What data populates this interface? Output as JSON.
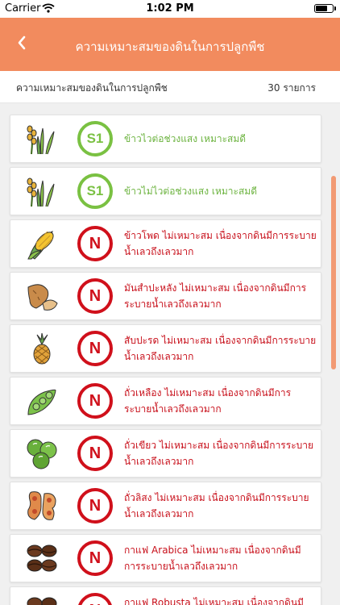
{
  "status_bar": {
    "carrier": "Carrier",
    "time": "1:02 PM"
  },
  "nav": {
    "title": "ความเหมาะสมของดินในการปลูกพืช"
  },
  "summary": {
    "label": "ความเหมาะสมของดินในการปลูกพืช",
    "count": "30 รายการ"
  },
  "colors": {
    "accent": "#f28b5e",
    "suitable": "#7ac142",
    "unsuitable": "#d0101b"
  },
  "items": [
    {
      "icon": "rice-icon",
      "badge": "S1",
      "status": "suitable",
      "text": "ข้าวไวต่อช่วงแสง เหมาะสมดี"
    },
    {
      "icon": "rice-icon",
      "badge": "S1",
      "status": "suitable",
      "text": "ข้าวไม่ไวต่อช่วงแสง เหมาะสมดี"
    },
    {
      "icon": "corn-icon",
      "badge": "N",
      "status": "unsuitable",
      "text": "ข้าวโพด ไม่เหมาะสม เนื่องจากดินมีการระบายน้ำเลวถึงเลวมาก"
    },
    {
      "icon": "cassava-icon",
      "badge": "N",
      "status": "unsuitable",
      "text": "มันสำปะหลัง ไม่เหมาะสม เนื่องจากดินมีการระบายน้ำเลวถึงเลวมาก"
    },
    {
      "icon": "pineapple-icon",
      "badge": "N",
      "status": "unsuitable",
      "text": "สับปะรด ไม่เหมาะสม เนื่องจากดินมีการระบายน้ำเลวถึงเลวมาก"
    },
    {
      "icon": "soybean-icon",
      "badge": "N",
      "status": "unsuitable",
      "text": "ถั่วเหลือง ไม่เหมาะสม เนื่องจากดินมีการระบายน้ำเลวถึงเลวมาก"
    },
    {
      "icon": "mungbean-icon",
      "badge": "N",
      "status": "unsuitable",
      "text": "ถั่วเขียว ไม่เหมาะสม เนื่องจากดินมีการระบายน้ำเลวถึงเลวมาก"
    },
    {
      "icon": "peanut-icon",
      "badge": "N",
      "status": "unsuitable",
      "text": "ถั่วลิสง ไม่เหมาะสม เนื่องจากดินมีการระบายน้ำเลวถึงเลวมาก"
    },
    {
      "icon": "coffee-bean-icon",
      "badge": "N",
      "status": "unsuitable",
      "text": "กาแฟ Arabica ไม่เหมาะสม เนื่องจากดินมีการระบายน้ำเลวถึงเลวมาก"
    },
    {
      "icon": "coffee-bean-icon",
      "badge": "N",
      "status": "unsuitable",
      "text": "กาแฟ Robusta ไม่เหมาะสม เนื่องจากดินมีการระบายน้ำเลวถึงเลวมาก"
    }
  ]
}
